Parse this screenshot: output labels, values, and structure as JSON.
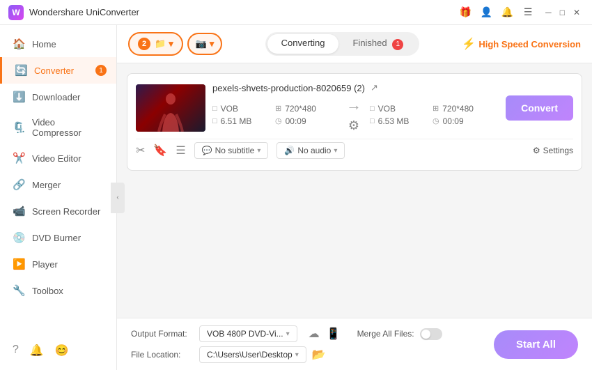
{
  "titlebar": {
    "app_name": "Wondershare UniConverter",
    "icons": {
      "gift": "🎁",
      "user": "👤",
      "bell": "🔔"
    }
  },
  "sidebar": {
    "items": [
      {
        "id": "home",
        "label": "Home",
        "icon": "🏠",
        "active": false
      },
      {
        "id": "converter",
        "label": "Converter",
        "icon": "🔄",
        "active": true,
        "badge": "1"
      },
      {
        "id": "downloader",
        "label": "Downloader",
        "icon": "⬇️",
        "active": false
      },
      {
        "id": "video_compressor",
        "label": "Video Compressor",
        "icon": "🗜️",
        "active": false
      },
      {
        "id": "video_editor",
        "label": "Video Editor",
        "icon": "✂️",
        "active": false
      },
      {
        "id": "merger",
        "label": "Merger",
        "icon": "🔗",
        "active": false
      },
      {
        "id": "screen_recorder",
        "label": "Screen Recorder",
        "icon": "📹",
        "active": false
      },
      {
        "id": "dvd_burner",
        "label": "DVD Burner",
        "icon": "💿",
        "active": false
      },
      {
        "id": "player",
        "label": "Player",
        "icon": "▶️",
        "active": false
      },
      {
        "id": "toolbox",
        "label": "Toolbox",
        "icon": "🔧",
        "active": false
      }
    ],
    "bottom_icons": [
      "?",
      "🔔",
      "😊"
    ]
  },
  "toolbar": {
    "add_badge": "2",
    "add_files_label": "Add Files ▾",
    "add_icon_label": "+",
    "tabs": [
      {
        "label": "Converting",
        "active": true
      },
      {
        "label": "Finished",
        "active": false
      }
    ],
    "finished_badge": "1",
    "high_speed_label": "High Speed Conversion"
  },
  "file_item": {
    "filename": "pexels-shvets-production-8020659 (2)",
    "source": {
      "format": "VOB",
      "resolution": "720*480",
      "size": "6.51 MB",
      "duration": "00:09"
    },
    "target": {
      "format": "VOB",
      "resolution": "720*480",
      "size": "6.53 MB",
      "duration": "00:09"
    },
    "subtitle": "No subtitle",
    "audio": "No audio",
    "settings_label": "Settings",
    "convert_btn": "Convert"
  },
  "bottom_bar": {
    "output_format_label": "Output Format:",
    "output_format_value": "VOB 480P DVD-Vi...",
    "file_location_label": "File Location:",
    "file_location_value": "C:\\Users\\User\\Desktop",
    "merge_label": "Merge All Files:",
    "start_btn": "Start All"
  }
}
